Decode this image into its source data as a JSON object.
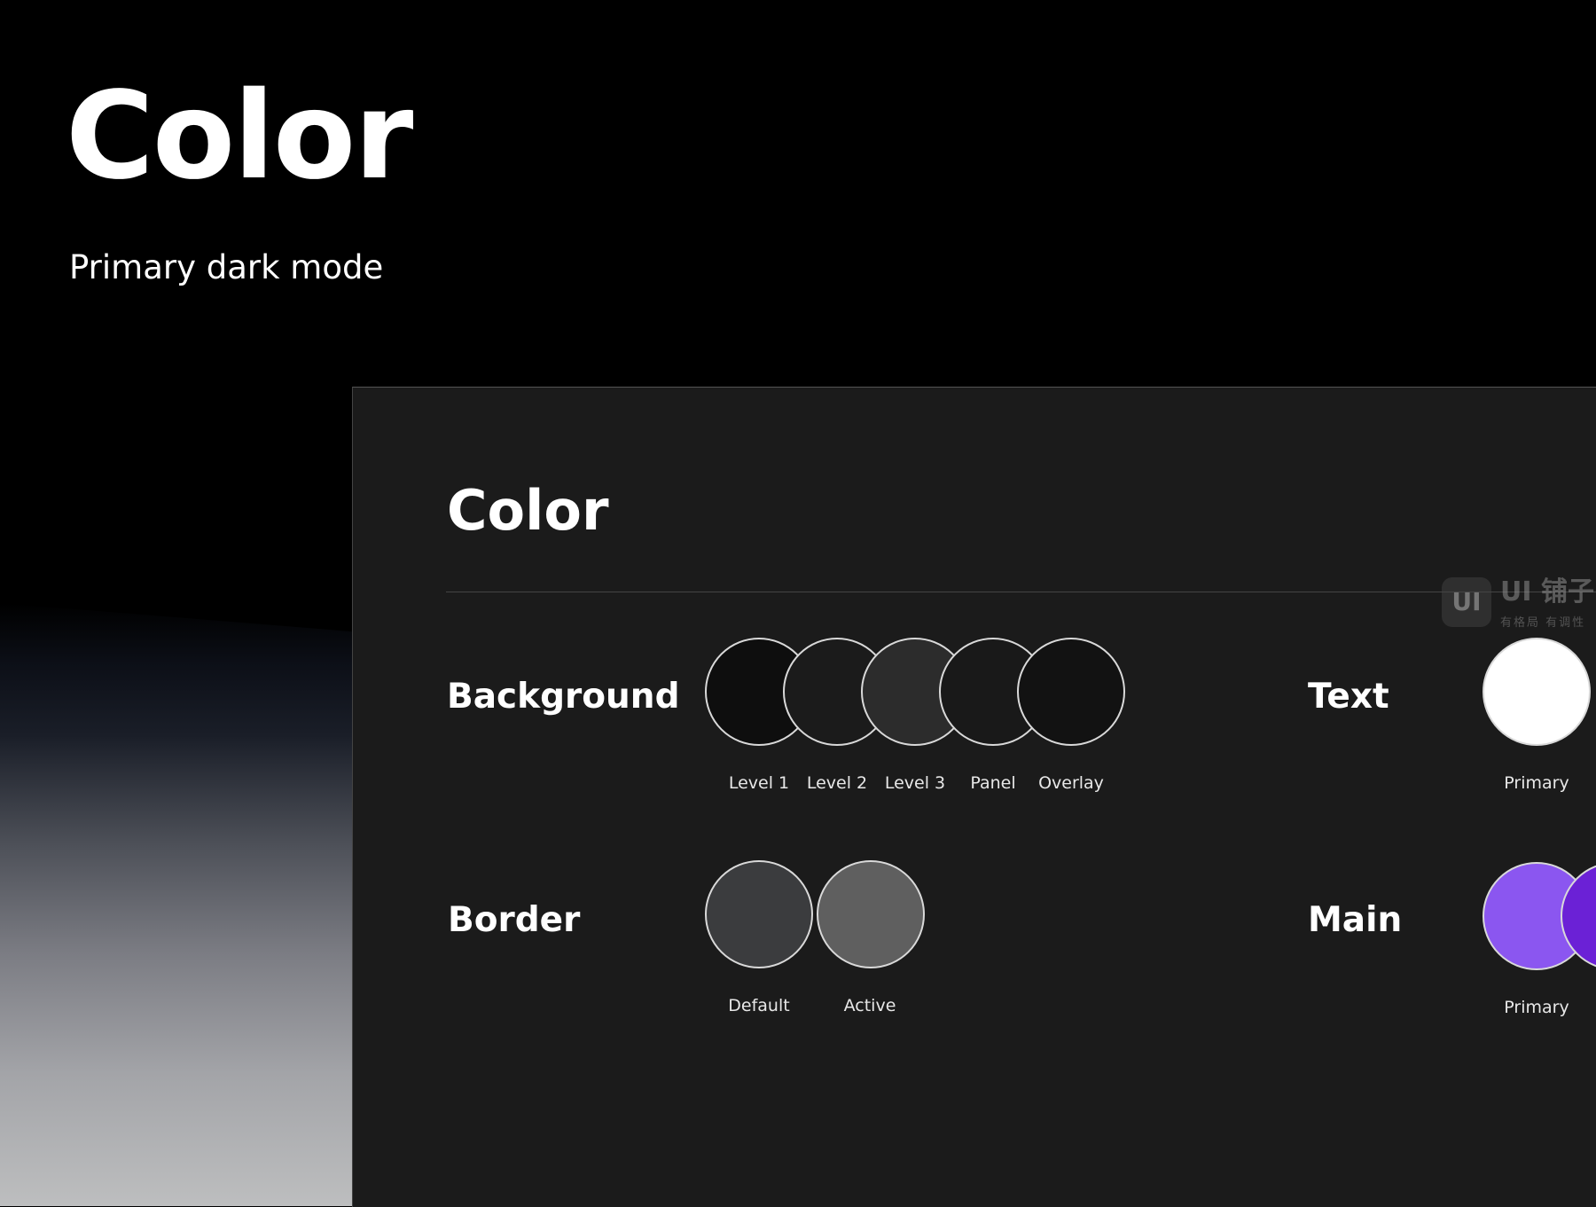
{
  "hero": {
    "title": "Color",
    "subtitle": "Primary dark mode"
  },
  "panel": {
    "title": "Color",
    "watermark": {
      "badge": "UI",
      "name": "UI 铺子",
      "tagline": "有格局 有调性"
    },
    "groups": {
      "background": {
        "label": "Background",
        "swatches": [
          {
            "label": "Level 1",
            "color": "#0e0e0e"
          },
          {
            "label": "Level 2",
            "color": "#1b1b1b"
          },
          {
            "label": "Level 3",
            "color": "#2c2c2c"
          },
          {
            "label": "Panel",
            "color": "#191919"
          },
          {
            "label": "Overlay",
            "color": "#121212"
          }
        ]
      },
      "border": {
        "label": "Border",
        "swatches": [
          {
            "label": "Default",
            "color": "#3b3c3e"
          },
          {
            "label": "Active",
            "color": "#5f5f5f"
          }
        ]
      },
      "text": {
        "label": "Text",
        "swatches": [
          {
            "label": "Primary",
            "color": "#ffffff"
          }
        ]
      },
      "main": {
        "label": "Main",
        "swatches": [
          {
            "label": "Primary",
            "color": "#8b56f0"
          },
          {
            "label": "",
            "color": "#6b21d6"
          }
        ]
      }
    }
  },
  "colors": {
    "page_background": "#000000",
    "panel_background": "#1b1b1b",
    "swatch_border": "#d9d9d9"
  }
}
